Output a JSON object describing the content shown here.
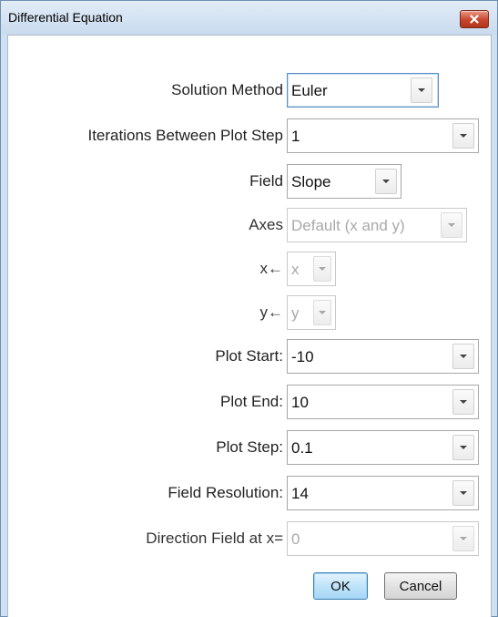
{
  "window": {
    "title": "Differential Equation"
  },
  "fields": [
    {
      "label": "Solution Method",
      "value": "Euler",
      "enabled": true
    },
    {
      "label": "Iterations Between Plot Step",
      "value": "1",
      "enabled": true
    },
    {
      "label": "Field",
      "value": "Slope",
      "enabled": true
    },
    {
      "label": "Axes",
      "value": "Default (x and y)",
      "enabled": false
    },
    {
      "label": "x←",
      "value": "x",
      "enabled": false
    },
    {
      "label": "y←",
      "value": "y",
      "enabled": false
    },
    {
      "label": "Plot Start:",
      "value": "-10",
      "enabled": true
    },
    {
      "label": "Plot End:",
      "value": "10",
      "enabled": true
    },
    {
      "label": "Plot Step:",
      "value": "0.1",
      "enabled": true
    },
    {
      "label": "Field Resolution:",
      "value": "14",
      "enabled": true
    },
    {
      "label": "Direction Field at x=",
      "value": "0",
      "enabled": false
    }
  ],
  "buttons": {
    "ok": "OK",
    "cancel": "Cancel"
  },
  "icons": {
    "close": "close-icon",
    "dropdown": "chevron-down-icon"
  },
  "colors": {
    "close_button": "#c8452d",
    "ok_button": "#bfe3f9",
    "focus_border": "#5a8fc5"
  }
}
